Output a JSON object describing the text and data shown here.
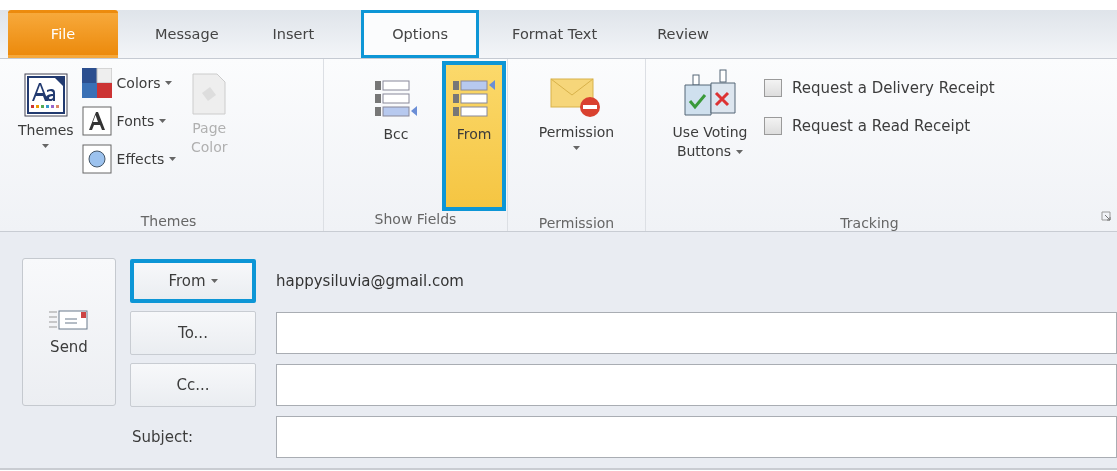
{
  "tabs": [
    {
      "label": "File",
      "kind": "file",
      "selected": false,
      "highlighted": false
    },
    {
      "label": "Message",
      "kind": "tab",
      "selected": false,
      "highlighted": false
    },
    {
      "label": "Insert",
      "kind": "tab",
      "selected": false,
      "highlighted": false
    },
    {
      "label": "Options",
      "kind": "tab",
      "selected": true,
      "highlighted": true
    },
    {
      "label": "Format Text",
      "kind": "tab",
      "selected": false,
      "highlighted": false
    },
    {
      "label": "Review",
      "kind": "tab",
      "selected": false,
      "highlighted": false
    }
  ],
  "ribbon": {
    "themes": {
      "label": "Themes",
      "themes_button": {
        "label": "Themes"
      },
      "commands": [
        {
          "label": "Colors",
          "kind": "colors"
        },
        {
          "label": "Fonts",
          "kind": "fonts"
        },
        {
          "label": "Effects",
          "kind": "effects"
        }
      ],
      "page_color": {
        "label": "Page Color",
        "disabled": true
      }
    },
    "show_fields": {
      "label": "Show Fields",
      "buttons": [
        {
          "label": "Bcc",
          "selected": false,
          "highlighted": false
        },
        {
          "label": "From",
          "selected": true,
          "highlighted": true
        }
      ]
    },
    "permission": {
      "label": "Permission",
      "button": {
        "label": "Permission"
      }
    },
    "tracking": {
      "label": "Tracking",
      "voting": {
        "label": "Use Voting Buttons"
      },
      "checkboxes": [
        {
          "label": "Request a Delivery Receipt",
          "checked": false
        },
        {
          "label": "Request a Read Receipt",
          "checked": false
        }
      ]
    }
  },
  "compose": {
    "send": {
      "label": "Send"
    },
    "from": {
      "label": "From",
      "highlighted": true,
      "value": "happysiluvia@gmail.com"
    },
    "to": {
      "label": "To..."
    },
    "cc": {
      "label": "Cc..."
    },
    "subject": {
      "label": "Subject:"
    }
  }
}
